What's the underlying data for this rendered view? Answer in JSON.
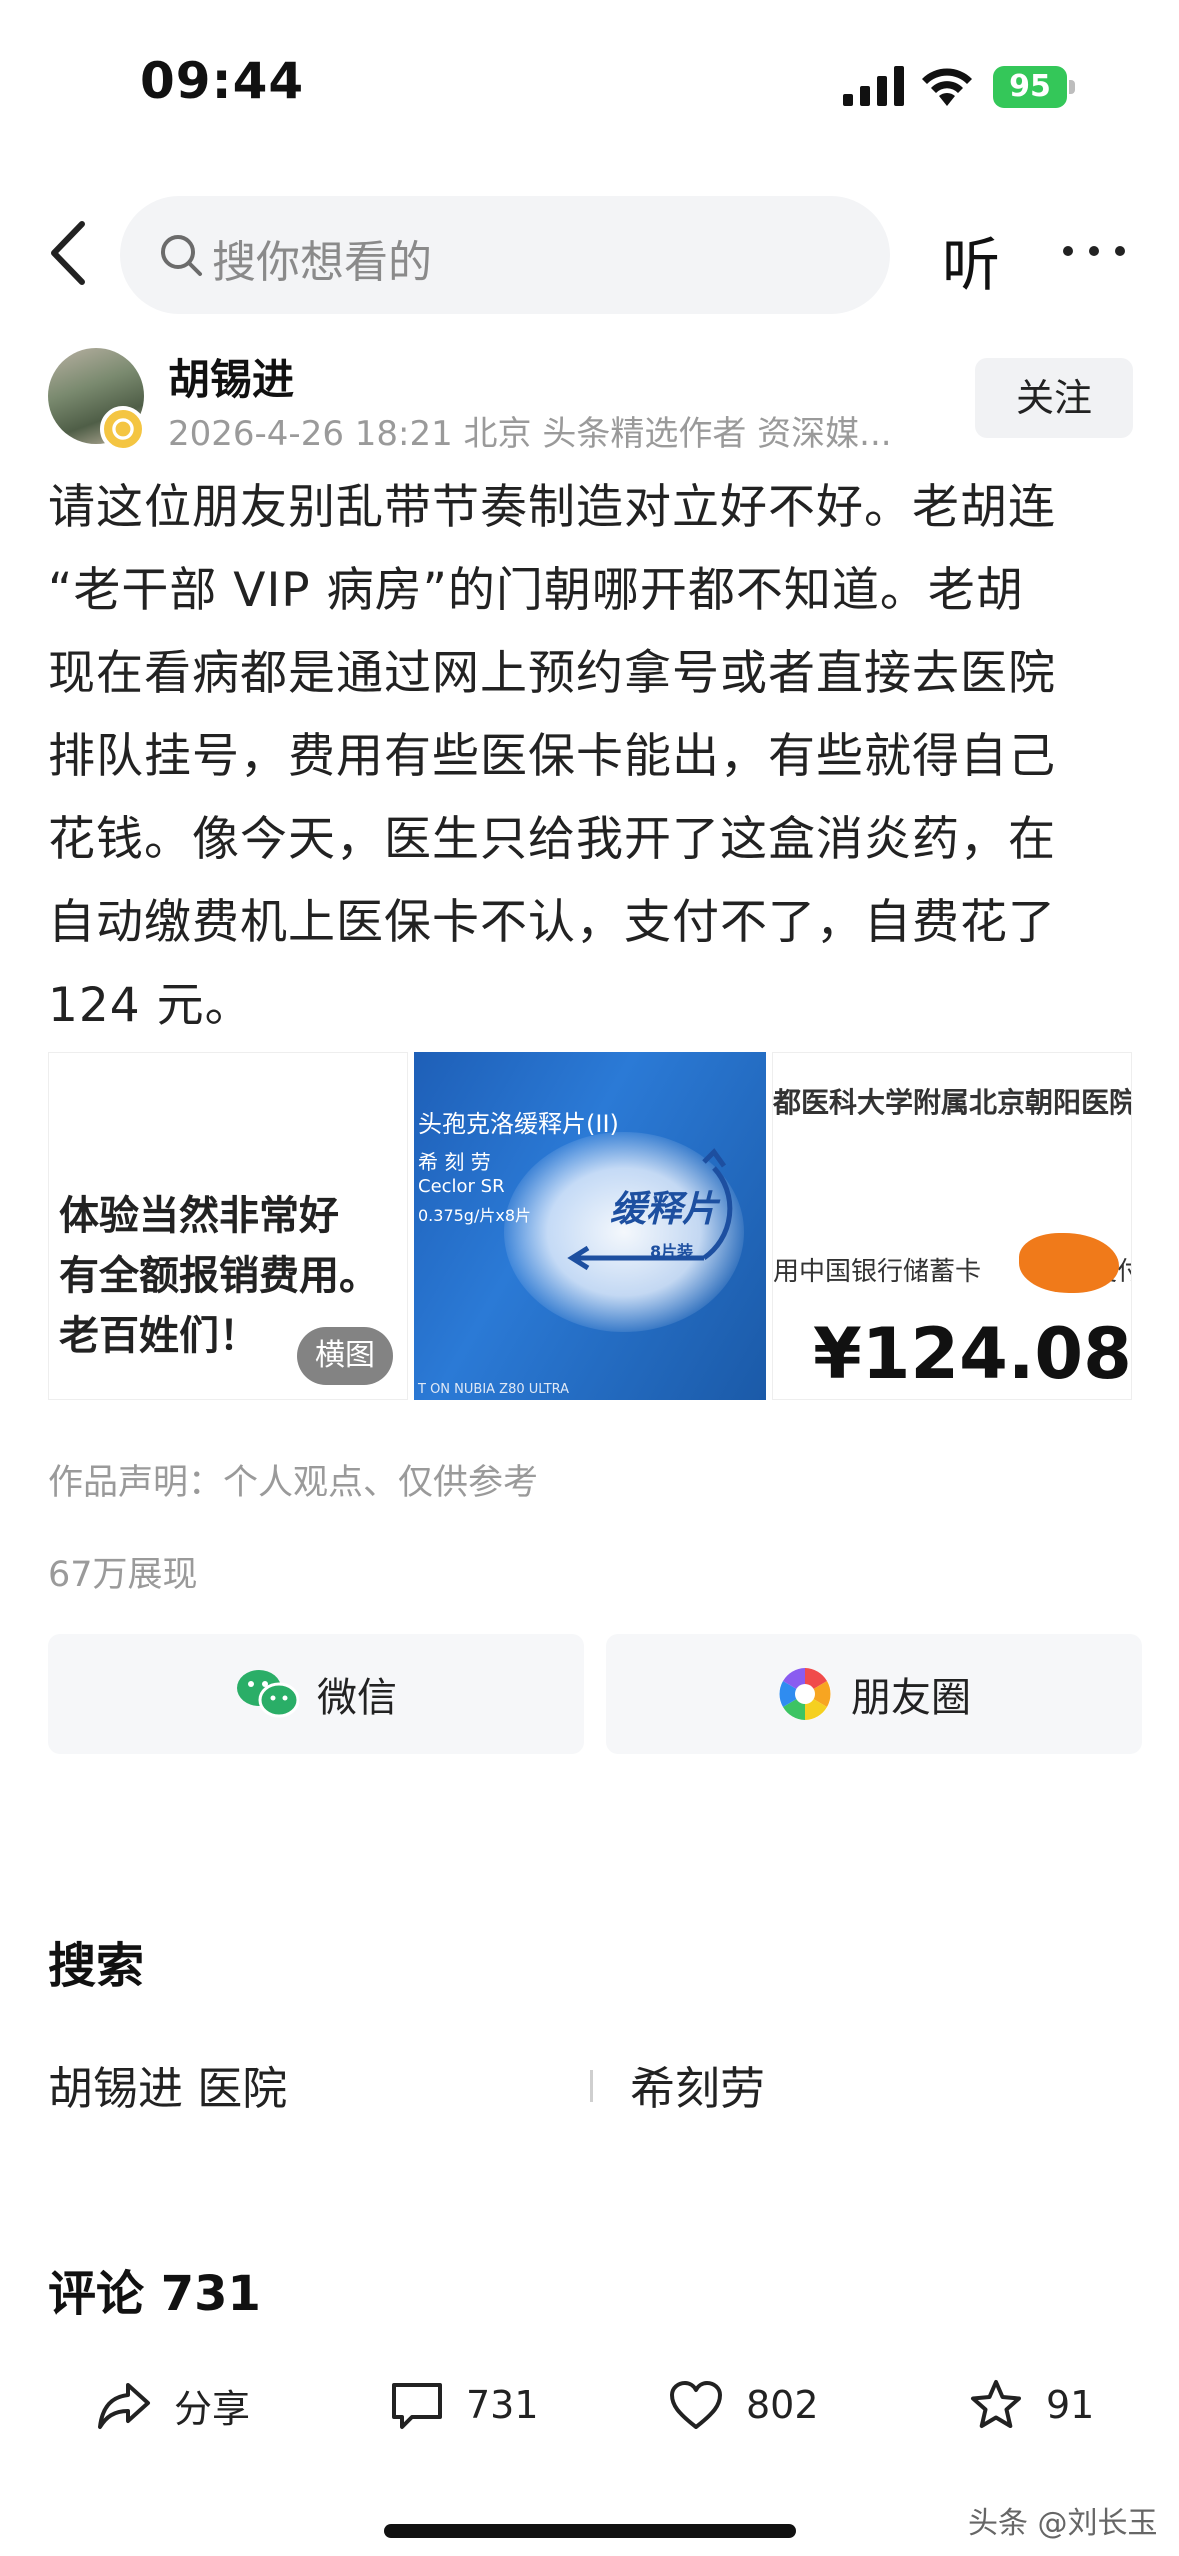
{
  "status_bar": {
    "time": "09:44",
    "battery": "95"
  },
  "nav": {
    "search_placeholder": "搜你想看的",
    "listen_label": "听"
  },
  "author": {
    "name": "胡锡进",
    "meta": "2026-4-26 18:21  北京  头条精选作者 资深媒...",
    "follow_label": "关注"
  },
  "post": {
    "lines": [
      "请这位朋友别乱带节奏制造对立好不好。老胡连",
      "“老干部 VIP 病房”的门朝哪开都不知道。老胡",
      "现在看病都是通过网上预约拿号或者直接去医院",
      "排队挂号，费用有些医保卡能出，有些就得自己",
      "花钱。像今天，医生只给我开了这盒消炎药，在",
      "自动缴费机上医保卡不认，支付不了，自费花了",
      "124 元。"
    ],
    "images": {
      "img1": {
        "lines": [
          "体验当然非常好",
          "有全额报销费用。",
          "老百姓们！"
        ],
        "tag": "横图"
      },
      "img2": {
        "title": "头孢克洛缓释片(II)",
        "brand": "希 刻 劳",
        "sr": "Ceclor SR",
        "dose": "0.375g/片x8片",
        "slow": "缓释片",
        "pieces": "8片装",
        "foot": "T ON NUBIA Z80 ULTRA"
      },
      "img3": {
        "hospital": "都医科大学附属北京朝阳医院",
        "bank": "用中国银行储蓄卡",
        "bank_tail": "支付",
        "amount": "¥124.08"
      }
    },
    "declaration": "作品声明：个人观点、仅供参考",
    "views": "67万展现"
  },
  "share": {
    "wechat": "微信",
    "moments": "朋友圈"
  },
  "search_section": {
    "title": "搜索",
    "terms": [
      "胡锡进 医院",
      "希刻劳"
    ]
  },
  "comments": {
    "title": "评论 731"
  },
  "actions": {
    "share": "分享",
    "comment": "731",
    "like": "802",
    "favorite": "91"
  },
  "watermark": "头条 @刘长玉",
  "colors": {
    "battery": "#34c759",
    "wechat": "#2aae67",
    "accent_blue": "#2b7ad6"
  }
}
